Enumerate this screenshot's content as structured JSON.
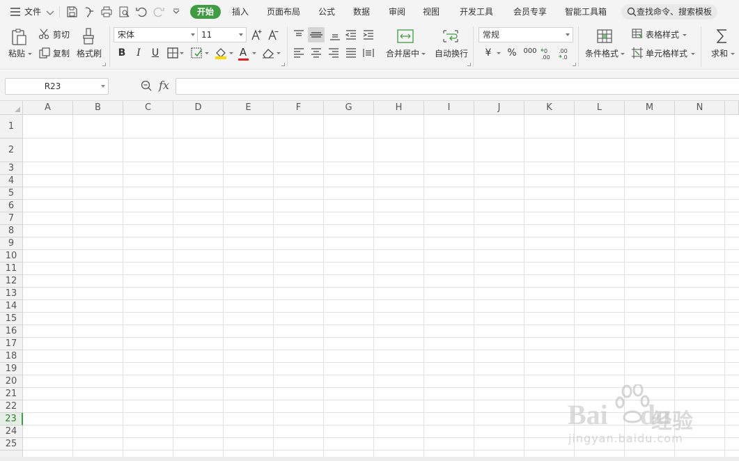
{
  "menu": {
    "file_label": "文件",
    "tabs": [
      "开始",
      "插入",
      "页面布局",
      "公式",
      "数据",
      "审阅",
      "视图",
      "开发工具",
      "会员专享",
      "智能工具箱"
    ],
    "active_tab": "开始",
    "search_placeholder": "查找命令、搜索模板"
  },
  "ribbon": {
    "paste": "粘贴",
    "cut": "剪切",
    "copy": "复制",
    "format_painter": "格式刷",
    "font_name": "宋体",
    "font_size": "11",
    "bold": "B",
    "italic": "I",
    "underline": "U",
    "font_color_letter": "A",
    "merge_center": "合并居中",
    "wrap_text": "自动换行",
    "number_format": "常规",
    "currency": "¥",
    "percent": "%",
    "thousands": "000",
    "cond_format": "条件格式",
    "table_style": "表格样式",
    "cell_style": "单元格样式",
    "sum": "求和"
  },
  "formula_bar": {
    "name_box": "R23",
    "fx": "fx",
    "formula": ""
  },
  "grid": {
    "columns": [
      "A",
      "B",
      "C",
      "D",
      "E",
      "F",
      "G",
      "H",
      "I",
      "J",
      "K",
      "L",
      "M",
      "N"
    ],
    "rows": [
      "1",
      "2",
      "3",
      "4",
      "5",
      "6",
      "7",
      "8",
      "9",
      "10",
      "11",
      "12",
      "13",
      "14",
      "15",
      "16",
      "17",
      "18",
      "19",
      "20",
      "21",
      "22",
      "23",
      "24",
      "25"
    ],
    "active_row": "23"
  },
  "watermark": {
    "brand": "Bai",
    "brand2": "du",
    "cn": "经验",
    "url": "jingyan.baidu.com"
  },
  "colors": {
    "accent": "#3f9c43",
    "font_color_bar": "#e02020",
    "fill_color_bar": "#ffd800"
  }
}
